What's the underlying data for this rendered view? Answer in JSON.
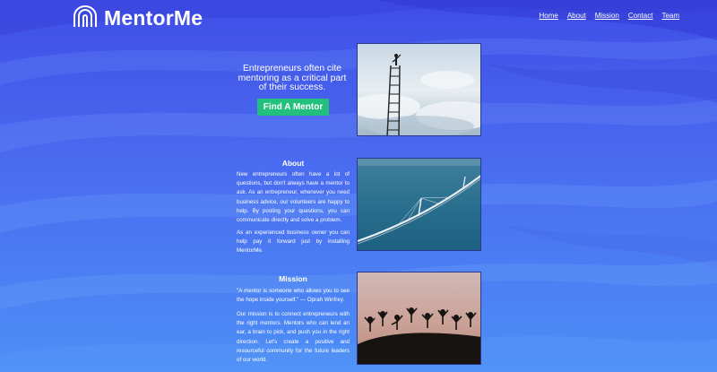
{
  "brand": {
    "name": "MentorMe",
    "logo_icon": "magnet-arch-icon"
  },
  "nav": {
    "items": [
      "Home",
      "About",
      "Mission",
      "Contact",
      "Team"
    ]
  },
  "hero": {
    "tagline": "Entrepreneurs often cite mentoring as a critical part of their success.",
    "cta_label": "Find A Mentor",
    "image_icon": "ladder-to-sky-photo"
  },
  "about": {
    "title": "About",
    "paragraphs": [
      "New entrepreneurs often have a lot of questions, but don't always have a mentor to ask. As an entrepreneur, whenever you need business advice, our volunteers are happy to help. By posting your questions, you can communicate directly and solve a problem.",
      "As an experienced business owner you can help pay it forward just by installing MentorMe."
    ],
    "image_icon": "bridge-over-water-photo"
  },
  "mission": {
    "title": "Mission",
    "quote": "\"A mentor is someone who allows you to see the hope inside yourself.\" — Oprah Winfrey.",
    "paragraph": "Our mission is to connect entrepreneurs with the right mentors. Mentors who can lend an ear, a brain to pick, and push you in the right direction. Let's create a positive and resourceful community for the future leaders of our world.",
    "image_icon": "people-jumping-silhouette-photo"
  },
  "colors": {
    "bg_top": "#3f4ee6",
    "bg_bottom": "#4d8ff6",
    "cta": "#22c07c",
    "text": "#ffffff"
  }
}
